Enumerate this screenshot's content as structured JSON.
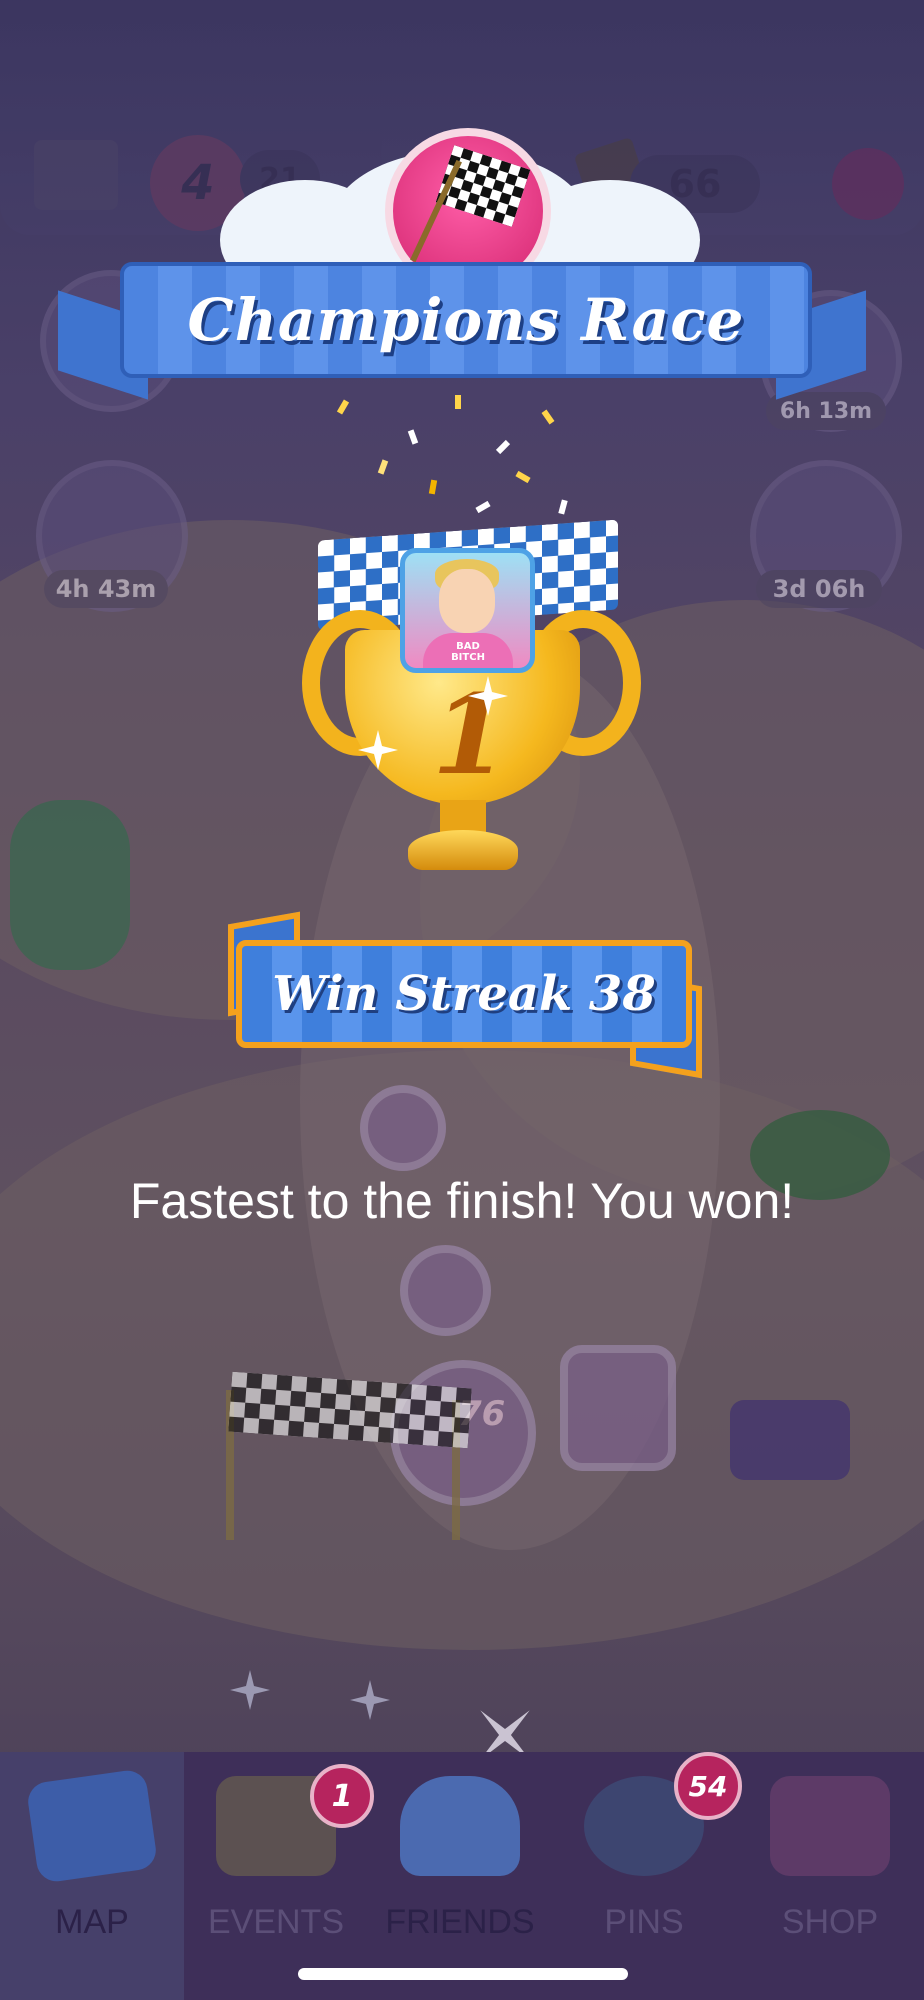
{
  "top_bar": {
    "lives": "4",
    "lives_partial_count": "21",
    "currency": "66"
  },
  "side_timers": {
    "left": "4h 43m",
    "right_top": "6h 13m",
    "right": "3d 06h"
  },
  "map_level_number": "76",
  "popup": {
    "title": "Champions Race",
    "rank": "1",
    "streak": "Win Streak 38",
    "message": "Fastest to the finish! You won!",
    "avatar_shirt_text": "BAD BITCH"
  },
  "nav": {
    "items": [
      {
        "label": "MAP",
        "active": true
      },
      {
        "label": "EVENTS",
        "badge": "1"
      },
      {
        "label": "FRIENDS"
      },
      {
        "label": "PINS",
        "badge": "54"
      },
      {
        "label": "SHOP"
      }
    ]
  },
  "colors": {
    "ribbon_blue": "#4d84e0",
    "gold": "#f5b81e",
    "overlay_purple": "#3e2f59",
    "badge_pink": "#b6245e"
  }
}
